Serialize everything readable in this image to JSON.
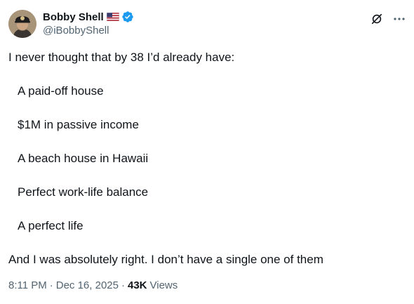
{
  "author": {
    "display_name": "Bobby Shell",
    "handle": "@iBobbyShell",
    "flag_icon": "us-flag-icon",
    "verified_icon": "verified-badge-icon",
    "verified_color": "#1d9bf0"
  },
  "actions": {
    "grok_icon": "grok-slash-icon",
    "more_icon": "more-dots-icon"
  },
  "tweet": {
    "intro": "I never thought that by 38 I’d already have:",
    "items": [
      "A paid-off house",
      "$1M in passive income",
      "A beach house in Hawaii",
      "Perfect work-life balance",
      "A perfect life"
    ],
    "closing": "And I was absolutely right. I don’t have a single one of them"
  },
  "meta": {
    "time": "8:11 PM",
    "separator": "·",
    "date": "Dec 16, 2025",
    "separator2": "·",
    "views_count": "43K",
    "views_label": "Views"
  },
  "colors": {
    "text_primary": "#0f1419",
    "text_secondary": "#536471",
    "background": "#ffffff"
  }
}
